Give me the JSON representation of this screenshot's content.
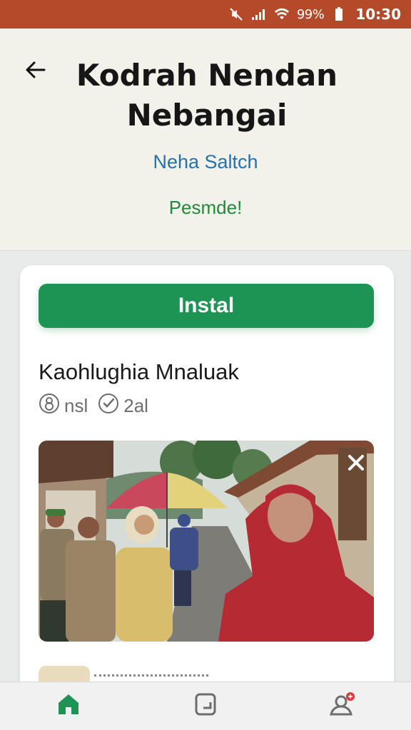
{
  "status_bar": {
    "battery": "99%",
    "time": "10:30",
    "icons": [
      "mute-icon",
      "signal-icon",
      "wifi-icon",
      "battery-icon"
    ]
  },
  "header": {
    "back_icon": "arrow-left-icon",
    "title": "Kodrah Nendan Nebangai",
    "subtitle": "Neha Saltch",
    "status": "Pesmde!"
  },
  "card": {
    "install_label": "Instal",
    "item_title": "Kaohlughia Mnaluak",
    "meta": [
      {
        "icon": "circle-8-icon",
        "text": "nsl"
      },
      {
        "icon": "check-circle-icon",
        "text": "2al"
      }
    ],
    "photo_close_icon": "close-icon"
  },
  "bottom_nav": {
    "items": [
      {
        "name": "home",
        "icon": "home-icon",
        "active": true
      },
      {
        "name": "library",
        "icon": "tablet-icon",
        "active": false
      },
      {
        "name": "profile",
        "icon": "user-badge-icon",
        "active": false
      }
    ]
  },
  "colors": {
    "status_bar": "#b54a2a",
    "accent_green": "#1d9354",
    "link_blue": "#2672a8",
    "status_green": "#1f8a3a",
    "header_bg": "#f2f1ea"
  }
}
